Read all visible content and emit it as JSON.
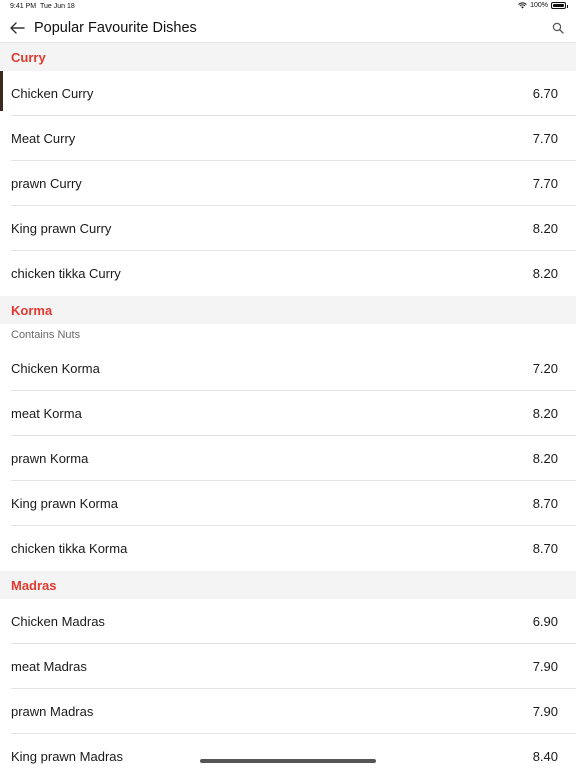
{
  "status_bar": {
    "time": "9:41 PM",
    "date": "Tue Jun 18",
    "battery": "100%",
    "battery_level": 1.0
  },
  "nav": {
    "back_icon": "arrow-left-icon",
    "title": "Popular Favourite Dishes",
    "search_icon": "search-icon"
  },
  "colors": {
    "section_title": "#e03a2f",
    "section_bg": "#f4f4f4",
    "divider": "#e4e4e4"
  },
  "sections": [
    {
      "title": "Curry",
      "note": "",
      "dishes": [
        {
          "name": "Chicken Curry",
          "price": "6.70"
        },
        {
          "name": "Meat Curry",
          "price": "7.70"
        },
        {
          "name": "prawn Curry",
          "price": "7.70"
        },
        {
          "name": "King prawn Curry",
          "price": "8.20"
        },
        {
          "name": "chicken tikka Curry",
          "price": "8.20"
        }
      ]
    },
    {
      "title": "Korma",
      "note": "Contains Nuts",
      "dishes": [
        {
          "name": "Chicken Korma",
          "price": "7.20"
        },
        {
          "name": "meat Korma",
          "price": "8.20"
        },
        {
          "name": "prawn Korma",
          "price": "8.20"
        },
        {
          "name": "King prawn Korma",
          "price": "8.70"
        },
        {
          "name": "chicken tikka Korma",
          "price": "8.70"
        }
      ]
    },
    {
      "title": "Madras",
      "note": "",
      "dishes": [
        {
          "name": "Chicken Madras",
          "price": "6.90"
        },
        {
          "name": "meat Madras",
          "price": "7.90"
        },
        {
          "name": "prawn Madras",
          "price": "7.90"
        },
        {
          "name": "King prawn Madras",
          "price": "8.40"
        }
      ]
    }
  ]
}
